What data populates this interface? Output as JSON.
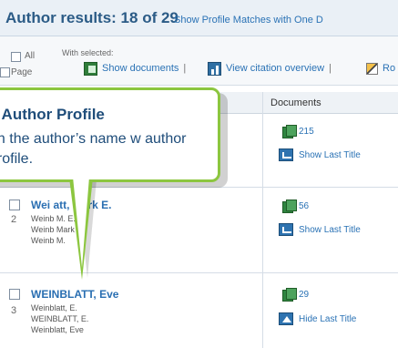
{
  "header": {
    "title": "Author results: 18 of 29",
    "profile_link": "Show Profile Matches with One D"
  },
  "toolbar": {
    "all_label": "All",
    "page_label": "Page",
    "with_selected_label": "With selected:",
    "show_documents_label": "Show documents",
    "separator": "|",
    "view_citation_label": "View citation overview",
    "next_action_partial": "Ro"
  },
  "table": {
    "documents_header": "Documents"
  },
  "rows": [
    {
      "number": "",
      "name": "",
      "variants": [],
      "doc_count": "215",
      "title_toggle": "Show Last Title"
    },
    {
      "number": "2",
      "name": "Wei  att, Mark E.",
      "variants": [
        "Weinb  M. E.",
        "Weinb  Mark",
        "Weinb  M."
      ],
      "doc_count": "56",
      "title_toggle": "Show Last Title"
    },
    {
      "number": "3",
      "name": "WEINBLATT, Eve",
      "variants": [
        "Weinblatt, E.",
        "WEINBLATT, E.",
        "Weinblatt, Eve"
      ],
      "doc_count": "29",
      "title_toggle": "Hide Last Title"
    }
  ],
  "callout": {
    "title": "y Author Profile",
    "text": " on the author’s name w author profile."
  }
}
